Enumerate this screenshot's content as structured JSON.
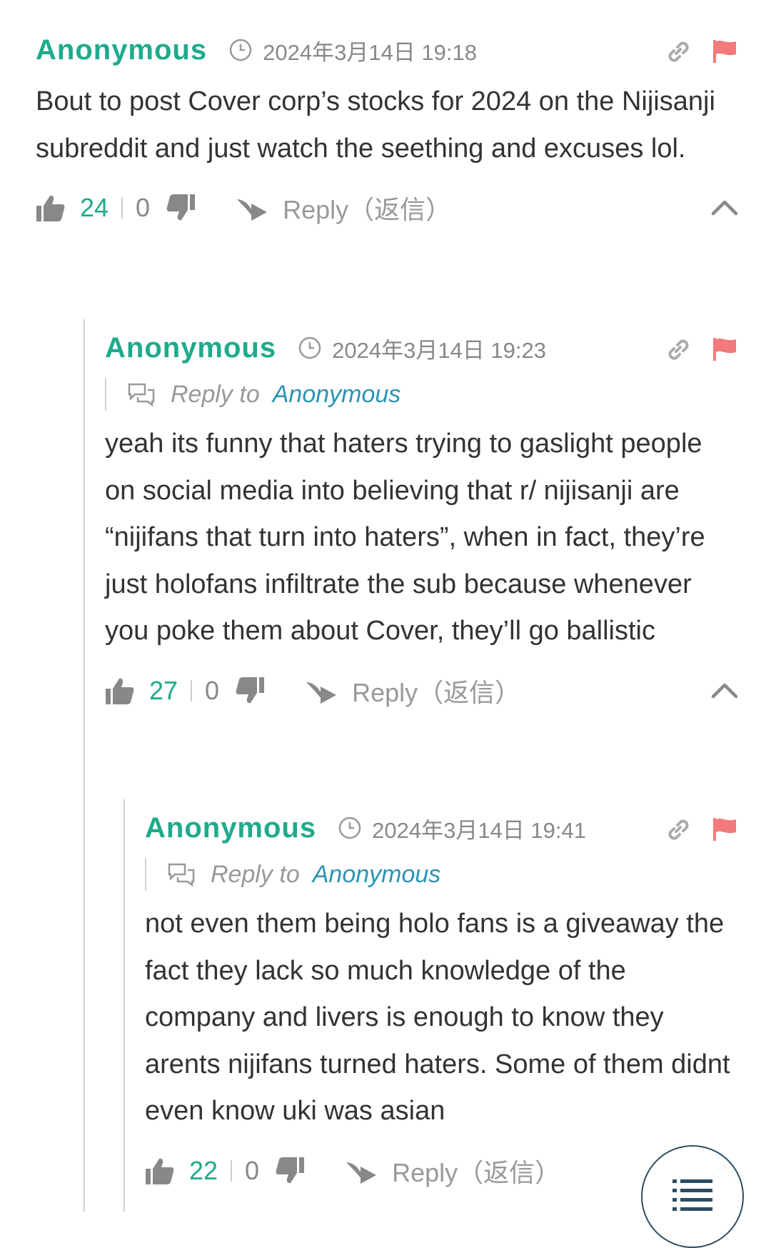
{
  "comments": [
    {
      "author": "Anonymous",
      "date": "2024年3月14日 19:18",
      "body": "Bout to post Cover corp’s stocks for 2024 on the Nijisanji subreddit and just watch the seething and excuses lol.",
      "likes": "24",
      "dislikes": "0",
      "reply_label": "Reply（返信）"
    },
    {
      "author": "Anonymous",
      "date": "2024年3月14日 19:23",
      "reply_to_label": "Reply to",
      "reply_to_name": "Anonymous",
      "body": "yeah its funny that haters trying to gaslight people on social media into believing that r/ nijisanji are “nijifans that turn into haters”, when in fact, they’re just holofans infiltrate the sub because whenever you poke them about Cover, they’ll go ballistic",
      "likes": "27",
      "dislikes": "0",
      "reply_label": "Reply（返信）"
    },
    {
      "author": "Anonymous",
      "date": "2024年3月14日 19:41",
      "reply_to_label": "Reply to",
      "reply_to_name": "Anonymous",
      "body": "not even them being holo fans is a giveaway the fact they lack so much knowledge of the company and livers is enough to know they arents nijifans turned haters. Some of them didnt even know uki was asian",
      "likes": "22",
      "dislikes": "0",
      "reply_label": "Reply（返信）"
    }
  ],
  "colors": {
    "author": "#1faa8c",
    "reply_to_name": "#2a93b5",
    "flag": "#f27a7a",
    "icon_gray": "#aaaaaa"
  },
  "icons": [
    "clock-icon",
    "link-icon",
    "flag-icon",
    "thumbs-up-icon",
    "thumbs-down-icon",
    "reply-arrow-icon",
    "chevron-up-icon",
    "chat-bubbles-icon",
    "list-menu-icon"
  ]
}
